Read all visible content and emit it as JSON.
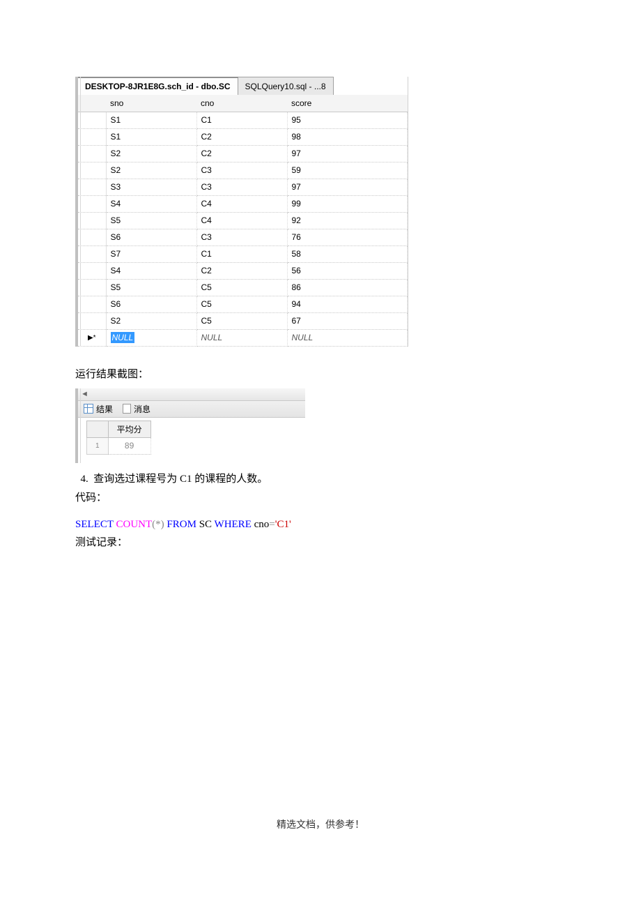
{
  "tabs": {
    "active": "DESKTOP-8JR1E8G.sch_id - dbo.SC",
    "inactive": "SQLQuery10.sql - ...8"
  },
  "table": {
    "headers": [
      "sno",
      "cno",
      "score"
    ],
    "rows": [
      {
        "sno": "S1",
        "cno": "C1",
        "score": "95"
      },
      {
        "sno": "S1",
        "cno": "C2",
        "score": "98"
      },
      {
        "sno": "S2",
        "cno": "C2",
        "score": "97"
      },
      {
        "sno": "S2",
        "cno": "C3",
        "score": "59"
      },
      {
        "sno": "S3",
        "cno": "C3",
        "score": "97"
      },
      {
        "sno": "S4",
        "cno": "C4",
        "score": "99"
      },
      {
        "sno": "S5",
        "cno": "C4",
        "score": "92"
      },
      {
        "sno": "S6",
        "cno": "C3",
        "score": "76"
      },
      {
        "sno": "S7",
        "cno": "C1",
        "score": "58"
      },
      {
        "sno": "S4",
        "cno": "C2",
        "score": "56"
      },
      {
        "sno": "S5",
        "cno": "C5",
        "score": "86"
      },
      {
        "sno": "S6",
        "cno": "C5",
        "score": "94"
      },
      {
        "sno": "S2",
        "cno": "C5",
        "score": "67"
      }
    ],
    "nullRow": {
      "marker": "▶*",
      "sno": "NULL",
      "cno": "NULL",
      "score": "NULL"
    }
  },
  "section1": "运行结果截图：",
  "resultTabs": {
    "tab1": "结果",
    "tab2": "消息"
  },
  "resultGrid": {
    "header": "平均分",
    "rownum": "1",
    "value": "89"
  },
  "question": {
    "num": "4.",
    "text": "查询选过课程号为 C1 的课程的人数。"
  },
  "codeLabel": "代码：",
  "sql": {
    "select": "SELECT",
    "count": "COUNT",
    "paren_open": "(",
    "star": "*",
    "paren_close": ")",
    "from": "FROM",
    "sc": "SC",
    "where": "WHERE",
    "cno": "cno",
    "eq": "=",
    "val": "'C1'"
  },
  "testLabel": "测试记录：",
  "footer": "精选文档，供参考！"
}
